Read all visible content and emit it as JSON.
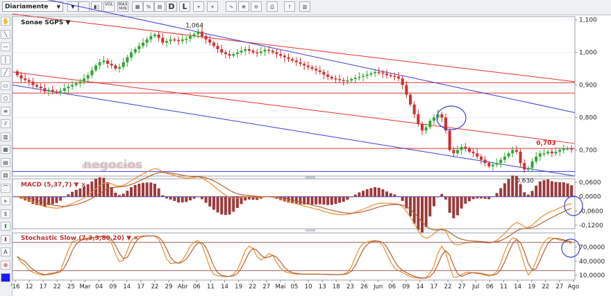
{
  "toolbar": {
    "period": "Diariamente",
    "buttons": [
      {
        "name": "indicators-button",
        "label": "▼"
      },
      {
        "name": "bar-type-button",
        "label": "⫶"
      },
      {
        "name": "candle-type-button",
        "label": "▮▯"
      },
      {
        "name": "vol-button",
        "label": "VOL"
      },
      {
        "name": "maxmin-button",
        "label": "MAX MIN"
      },
      {
        "name": "grid-button",
        "label": "▦"
      },
      {
        "name": "percent-button",
        "label": "%"
      },
      {
        "name": "compare-button",
        "label": "▤"
      },
      {
        "name": "d-button",
        "label": "D"
      },
      {
        "name": "l-button",
        "label": "L"
      },
      {
        "name": "crosshair-button",
        "label": "+"
      },
      {
        "name": "crosshair2-button",
        "label": "+"
      },
      {
        "name": "trend-button",
        "label": "∿"
      },
      {
        "name": "zoom-in-button",
        "label": "⊕"
      },
      {
        "name": "zoom-out-button",
        "label": "⊖"
      },
      {
        "name": "print-button",
        "label": "⎙"
      },
      {
        "name": "help-button",
        "label": "?"
      },
      {
        "name": "save-button",
        "label": "▥"
      }
    ]
  },
  "sidebar": {
    "items": [
      "✋",
      "╲",
      "—",
      "│",
      "╱",
      "▭",
      "○",
      "≡",
      "⫽",
      "▥",
      "▦",
      "▤",
      "▧",
      "⌒",
      "⫸",
      "$",
      "⬆",
      "⬇",
      "A",
      "⊗",
      "■"
    ]
  },
  "colors": {
    "bull": "#2fa82f",
    "bear": "#cf2e2e",
    "red_line": "#e03030",
    "blue_line": "#3a3ad8",
    "orange": "#f08a2a",
    "brown": "#b06030",
    "macd_bar": "#9a3a3a",
    "ref_line": "#9a6060"
  },
  "watermark": "negocios",
  "chart_data": [
    {
      "type": "candlestick",
      "title": "Sonae SGPS ▼",
      "yticks": [
        "1,100",
        "1,000",
        "0,900",
        "0,800",
        "0,700"
      ],
      "ylim": [
        0.62,
        1.11
      ],
      "annotations": {
        "high": "1,064",
        "low": "0,630",
        "last": "0,703"
      },
      "x_labels": [
        "'16",
        "12",
        "17",
        "22",
        "25",
        "Mar",
        "04",
        "09",
        "14",
        "17",
        "22",
        "29",
        "Abr",
        "06",
        "11",
        "14",
        "19",
        "22",
        "27",
        "Mai",
        "05",
        "10",
        "13",
        "18",
        "23",
        "26",
        "Jun",
        "06",
        "09",
        "14",
        "17",
        "22",
        "27",
        "Jul",
        "06",
        "11",
        "14",
        "19",
        "22",
        "27",
        "Ago"
      ],
      "closes": [
        0.93,
        0.92,
        0.915,
        0.91,
        0.9,
        0.895,
        0.89,
        0.88,
        0.885,
        0.88,
        0.878,
        0.882,
        0.89,
        0.895,
        0.9,
        0.905,
        0.91,
        0.92,
        0.93,
        0.945,
        0.96,
        0.97,
        0.975,
        0.965,
        0.96,
        0.95,
        0.955,
        0.97,
        0.985,
        1.0,
        1.01,
        1.02,
        1.03,
        1.04,
        1.05,
        1.055,
        1.045,
        1.03,
        1.035,
        1.04,
        1.038,
        1.035,
        1.04,
        1.042,
        1.05,
        1.056,
        1.064,
        1.05,
        1.04,
        1.03,
        1.02,
        1.01,
        1.0,
        0.995,
        0.99,
        0.995,
        1.0,
        1.005,
        1.01,
        1.005,
        1.0,
        0.998,
        1.003,
        1.008,
        1.005,
        1.0,
        0.995,
        0.99,
        0.985,
        0.98,
        0.975,
        0.97,
        0.965,
        0.96,
        0.955,
        0.95,
        0.945,
        0.94,
        0.932,
        0.925,
        0.92,
        0.918,
        0.915,
        0.912,
        0.914,
        0.918,
        0.922,
        0.925,
        0.928,
        0.932,
        0.936,
        0.94,
        0.938,
        0.935,
        0.93,
        0.928,
        0.926,
        0.92,
        0.9,
        0.87,
        0.84,
        0.81,
        0.78,
        0.76,
        0.77,
        0.79,
        0.8,
        0.81,
        0.8,
        0.76,
        0.7,
        0.69,
        0.7,
        0.71,
        0.705,
        0.695,
        0.69,
        0.68,
        0.67,
        0.66,
        0.65,
        0.655,
        0.66,
        0.67,
        0.68,
        0.69,
        0.7,
        0.695,
        0.66,
        0.64,
        0.645,
        0.665,
        0.68,
        0.69,
        0.69,
        0.695,
        0.69,
        0.695,
        0.7,
        0.705,
        0.705,
        0.703
      ]
    },
    {
      "type": "line+bar",
      "title": "MACD (5,37,7) ▼ ×",
      "yticks": [
        "0,0600",
        "0,0000",
        "-0,0600",
        "-0,1200"
      ],
      "ylim": [
        -0.135,
        0.075
      ]
    },
    {
      "type": "line",
      "title": "Stochastic Slow (7,3,3,80,20) ▼ ×",
      "yticks": [
        "70,0000",
        "40,0000",
        "10,0000"
      ],
      "ylim": [
        0,
        100
      ]
    }
  ]
}
